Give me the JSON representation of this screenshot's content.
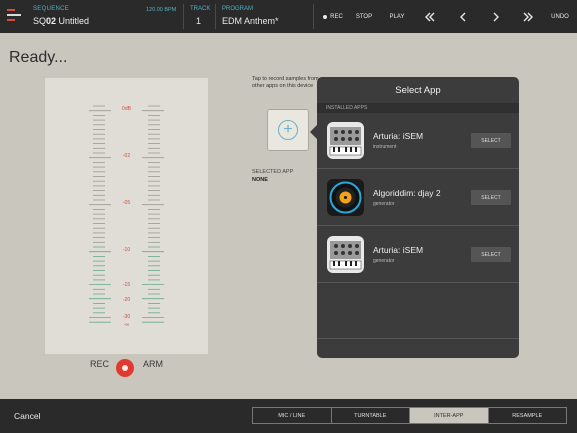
{
  "header": {
    "sequence_label": "SEQUENCE",
    "sequence_prefix": "SQ",
    "sequence_number": "02",
    "sequence_name": "Untitled",
    "tempo": "120.00 BPM",
    "track_label": "TRACK",
    "track_value": "1",
    "program_label": "PROGRAM",
    "program_value": "EDM Anthem*",
    "rec_label": "REC",
    "stop_label": "STOP",
    "play_label": "PLAY",
    "undo_label": "UNDO"
  },
  "main": {
    "status": "Ready...",
    "meter_ticks": [
      "0dB",
      "-02",
      "-05",
      "-10",
      "-15",
      "-20",
      "-30",
      "-∞"
    ],
    "rec_label": "REC",
    "arm_label": "ARM",
    "tap_text_line1": "Tap to record samples from",
    "tap_text_line2": "other apps on this device",
    "selected_app_label": "SELECTED APP",
    "selected_app_value": "NONE"
  },
  "popover": {
    "title": "Select App",
    "section": "INSTALLED APPS",
    "apps": [
      {
        "name": "Arturia: iSEM",
        "type": "instrument",
        "button": "SELECT",
        "icon": "synth-icon"
      },
      {
        "name": "Algoriddim: djay 2",
        "type": "generator",
        "button": "SELECT",
        "icon": "turntable-icon"
      },
      {
        "name": "Arturia: iSEM",
        "type": "generator",
        "button": "SELECT",
        "icon": "synth-icon"
      }
    ]
  },
  "footer": {
    "cancel": "Cancel",
    "sources": [
      "MIC / LINE",
      "TURNTABLE",
      "INTER-APP",
      "RESAMPLE"
    ],
    "active_source": "INTER-APP"
  },
  "colors": {
    "accent": "#4fb3c7",
    "record": "#e03a2e",
    "meter_green": "#6aa890"
  }
}
